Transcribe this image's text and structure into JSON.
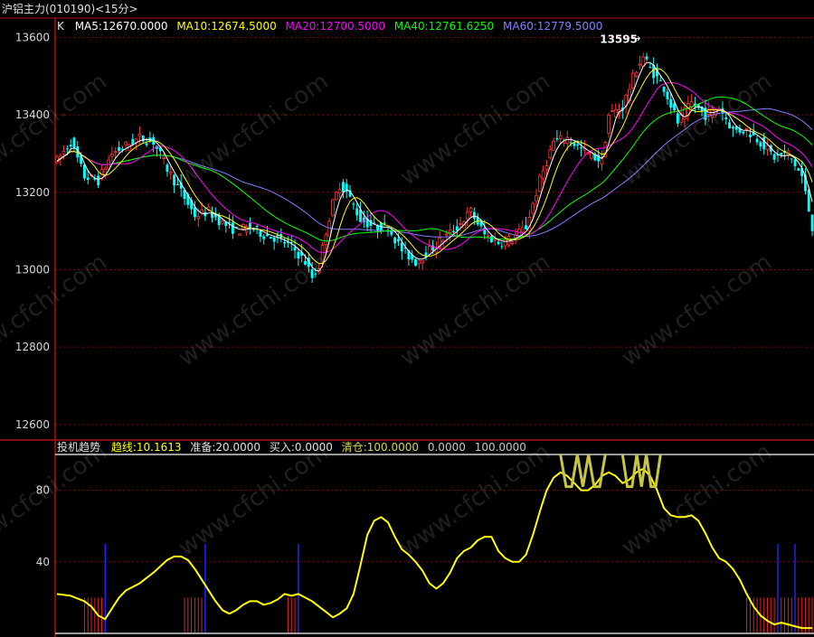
{
  "window": {
    "title": "沪铝主力(010190)<15分>"
  },
  "upper_legend": {
    "k_label": "K",
    "ma5": "MA5:12670.0000",
    "ma10": "MA10:12674.5000",
    "ma20": "MA20:12700.5000",
    "ma40": "MA40:12761.6250",
    "ma60": "MA60:12779.5000"
  },
  "lower_legend": {
    "name": "投机趋势",
    "trend": "趋线:10.1613",
    "prepare": "准备:20.0000",
    "buy": "买入:0.0000",
    "clear": "清仓:100.0000",
    "v1": "0.0000",
    "v2": "100.0000"
  },
  "peak_label": "13595",
  "colors": {
    "up": "#ff3232",
    "down": "#00ffff",
    "ma5": "#ffffff",
    "ma10": "#ffff00",
    "ma20": "#ff00ff",
    "ma40": "#00ff00",
    "ma60": "#8080ff",
    "trend": "#ffff00",
    "frame": "#b01010",
    "grid": "#8b0000"
  },
  "chart_data": [
    {
      "type": "candlestick",
      "title": "沪铝主力(010190)<15分>",
      "y_ticks": [
        12600,
        12800,
        13000,
        13200,
        13400,
        13600
      ],
      "ylim": [
        12560,
        13650
      ],
      "grid": true,
      "close_anchors": [
        [
          0,
          13280
        ],
        [
          4,
          13330
        ],
        [
          8,
          13240
        ],
        [
          12,
          13230
        ],
        [
          16,
          13300
        ],
        [
          20,
          13320
        ],
        [
          24,
          13340
        ],
        [
          28,
          13330
        ],
        [
          32,
          13260
        ],
        [
          36,
          13200
        ],
        [
          40,
          13140
        ],
        [
          44,
          13150
        ],
        [
          48,
          13120
        ],
        [
          52,
          13100
        ],
        [
          56,
          13110
        ],
        [
          60,
          13090
        ],
        [
          64,
          13080
        ],
        [
          68,
          13060
        ],
        [
          72,
          13020
        ],
        [
          74,
          12980
        ],
        [
          76,
          13010
        ],
        [
          78,
          13100
        ],
        [
          80,
          13170
        ],
        [
          82,
          13220
        ],
        [
          84,
          13200
        ],
        [
          88,
          13130
        ],
        [
          92,
          13110
        ],
        [
          96,
          13110
        ],
        [
          100,
          13050
        ],
        [
          104,
          13020
        ],
        [
          108,
          13050
        ],
        [
          112,
          13080
        ],
        [
          116,
          13110
        ],
        [
          120,
          13150
        ],
        [
          124,
          13090
        ],
        [
          128,
          13070
        ],
        [
          132,
          13080
        ],
        [
          136,
          13110
        ],
        [
          140,
          13230
        ],
        [
          144,
          13330
        ],
        [
          148,
          13340
        ],
        [
          152,
          13310
        ],
        [
          156,
          13290
        ],
        [
          158,
          13280
        ],
        [
          160,
          13400
        ],
        [
          164,
          13420
        ],
        [
          168,
          13520
        ],
        [
          170,
          13550
        ],
        [
          172,
          13520
        ],
        [
          176,
          13470
        ],
        [
          180,
          13380
        ],
        [
          184,
          13430
        ],
        [
          188,
          13400
        ],
        [
          192,
          13420
        ],
        [
          196,
          13360
        ],
        [
          200,
          13360
        ],
        [
          204,
          13330
        ],
        [
          208,
          13290
        ],
        [
          212,
          13300
        ],
        [
          216,
          13240
        ],
        [
          219,
          13110
        ]
      ],
      "ma_last": {
        "ma5": 12670.0,
        "ma10": 12674.5,
        "ma20": 12700.5,
        "ma40": 12761.625,
        "ma60": 12779.5
      },
      "annotations": [
        {
          "text": "13595",
          "bar": 170,
          "value": 13595
        }
      ]
    },
    {
      "type": "line",
      "title": "投机趋势",
      "y_ticks": [
        40,
        80
      ],
      "ylim": [
        0,
        100
      ],
      "series": [
        {
          "name": "趋线",
          "points": [
            [
              0,
              22
            ],
            [
              4,
              21
            ],
            [
              8,
              18
            ],
            [
              10,
              15
            ],
            [
              12,
              10
            ],
            [
              14,
              8
            ],
            [
              16,
              14
            ],
            [
              18,
              20
            ],
            [
              20,
              24
            ],
            [
              24,
              28
            ],
            [
              28,
              34
            ],
            [
              32,
              41
            ],
            [
              34,
              43
            ],
            [
              36,
              43
            ],
            [
              38,
              41
            ],
            [
              40,
              36
            ],
            [
              42,
              30
            ],
            [
              44,
              24
            ],
            [
              46,
              18
            ],
            [
              48,
              13
            ],
            [
              50,
              11
            ],
            [
              52,
              13
            ],
            [
              54,
              16
            ],
            [
              56,
              18
            ],
            [
              58,
              18
            ],
            [
              60,
              16
            ],
            [
              62,
              17
            ],
            [
              64,
              19
            ],
            [
              66,
              22
            ],
            [
              68,
              21
            ],
            [
              70,
              22
            ],
            [
              72,
              20
            ],
            [
              74,
              18
            ],
            [
              76,
              15
            ],
            [
              78,
              12
            ],
            [
              80,
              9
            ],
            [
              82,
              11
            ],
            [
              84,
              14
            ],
            [
              86,
              22
            ],
            [
              88,
              38
            ],
            [
              90,
              55
            ],
            [
              92,
              63
            ],
            [
              94,
              65
            ],
            [
              96,
              62
            ],
            [
              98,
              54
            ],
            [
              100,
              47
            ],
            [
              102,
              44
            ],
            [
              104,
              40
            ],
            [
              106,
              35
            ],
            [
              108,
              28
            ],
            [
              110,
              25
            ],
            [
              112,
              28
            ],
            [
              114,
              34
            ],
            [
              116,
              42
            ],
            [
              118,
              46
            ],
            [
              120,
              48
            ],
            [
              122,
              52
            ],
            [
              124,
              54
            ],
            [
              126,
              54
            ],
            [
              128,
              46
            ],
            [
              130,
              42
            ],
            [
              132,
              40
            ],
            [
              134,
              40
            ],
            [
              136,
              44
            ],
            [
              138,
              55
            ],
            [
              140,
              68
            ],
            [
              142,
              80
            ],
            [
              144,
              87
            ],
            [
              146,
              90
            ],
            [
              148,
              88
            ],
            [
              150,
              84
            ],
            [
              152,
              80
            ],
            [
              154,
              80
            ],
            [
              156,
              83
            ],
            [
              158,
              88
            ],
            [
              160,
              90
            ],
            [
              162,
              88
            ],
            [
              164,
              84
            ],
            [
              166,
              86
            ],
            [
              168,
              90
            ],
            [
              170,
              92
            ],
            [
              172,
              88
            ],
            [
              174,
              80
            ],
            [
              176,
              70
            ],
            [
              178,
              66
            ],
            [
              180,
              65
            ],
            [
              182,
              65
            ],
            [
              184,
              66
            ],
            [
              186,
              63
            ],
            [
              188,
              56
            ],
            [
              190,
              48
            ],
            [
              192,
              42
            ],
            [
              194,
              40
            ],
            [
              196,
              36
            ],
            [
              198,
              30
            ],
            [
              200,
              22
            ],
            [
              202,
              15
            ],
            [
              204,
              10
            ],
            [
              206,
              7
            ],
            [
              208,
              5
            ],
            [
              210,
              6
            ],
            [
              212,
              5
            ],
            [
              214,
              4
            ],
            [
              216,
              3
            ],
            [
              219,
              3
            ]
          ]
        },
        {
          "name": "准备",
          "value": 20
        },
        {
          "name": "买入",
          "value": 0
        },
        {
          "name": "清仓",
          "value": 100
        }
      ],
      "signal_bars": {
        "red_ranges": [
          [
            8,
            14
          ],
          [
            37,
            43
          ],
          [
            67,
            70
          ],
          [
            200,
            219
          ]
        ],
        "blue_bars": [
          14,
          43,
          70,
          209,
          214
        ]
      },
      "zigzag_ranges": [
        [
          146,
          159
        ],
        [
          164,
          175
        ]
      ]
    }
  ]
}
